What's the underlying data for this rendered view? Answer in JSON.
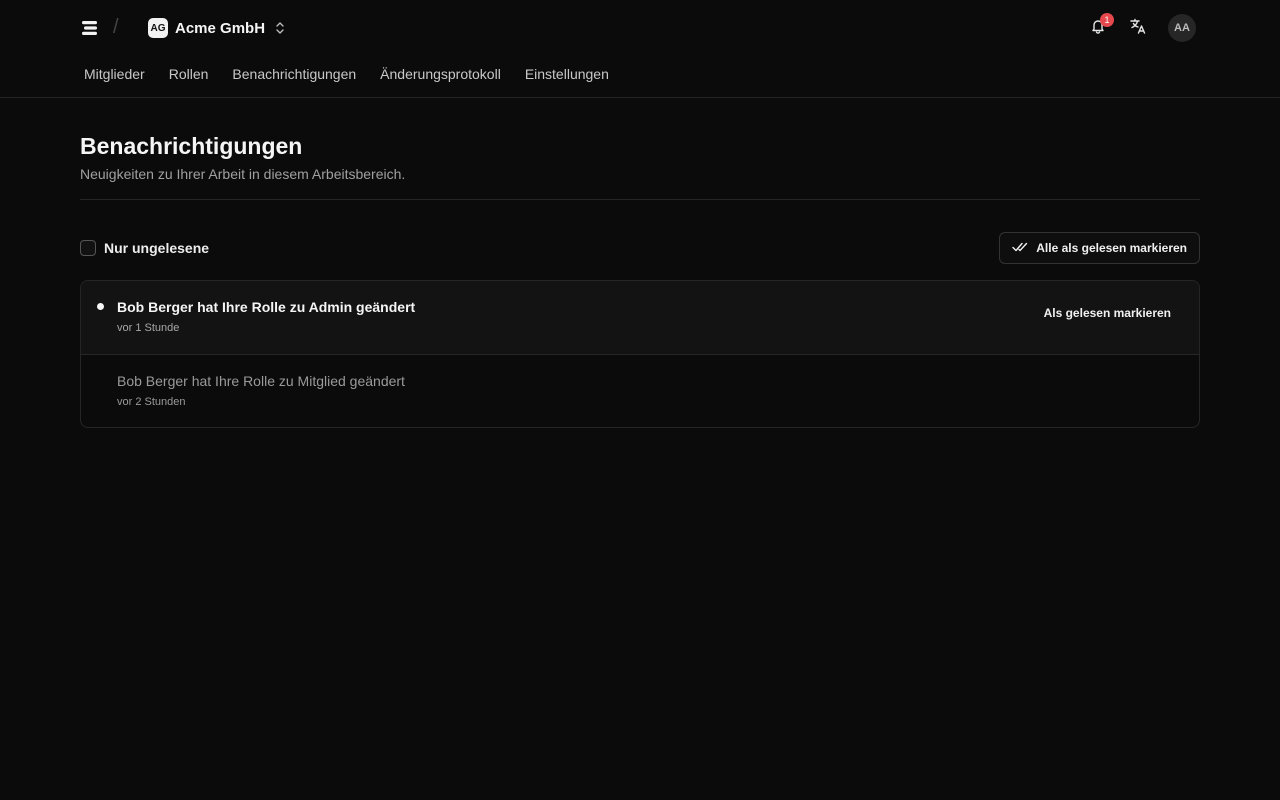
{
  "app": {
    "logo_icon": "stacked-layers-icon"
  },
  "workspace": {
    "badge": "AG",
    "name": "Acme GmbH",
    "chevron_icon": "chevron-up-down-icon"
  },
  "header": {
    "notifications_icon": "bell-icon",
    "notifications_count": "1",
    "language_icon": "translate-icon",
    "avatar_initials": "AA"
  },
  "nav": {
    "items": [
      {
        "label": "Mitglieder"
      },
      {
        "label": "Rollen"
      },
      {
        "label": "Benachrichtigungen"
      },
      {
        "label": "Änderungsprotokoll"
      },
      {
        "label": "Einstellungen"
      }
    ]
  },
  "page": {
    "title": "Benachrichtigungen",
    "subtitle": "Neuigkeiten zu Ihrer Arbeit in diesem Arbeitsbereich."
  },
  "toolbar": {
    "filter_label": "Nur ungelesene",
    "filter_checked": false,
    "mark_all_label": "Alle als gelesen markieren",
    "mark_all_icon": "double-check-icon"
  },
  "notifications": [
    {
      "title": "Bob Berger hat Ihre Rolle zu Admin geändert",
      "time": "vor 1 Stunde",
      "unread": true,
      "action_label": "Als gelesen markieren"
    },
    {
      "title": "Bob Berger hat Ihre Rolle zu Mitglied geändert",
      "time": "vor 2 Stunden",
      "unread": false
    }
  ],
  "colors": {
    "background": "#0b0b0b",
    "badge": "#e5484d",
    "text": "#ededed",
    "muted": "#9a9a9a"
  }
}
